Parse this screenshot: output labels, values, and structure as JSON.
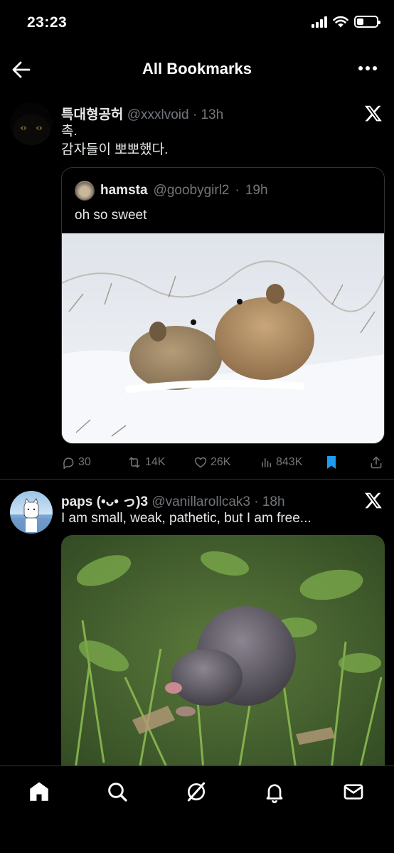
{
  "status_bar": {
    "time": "23:23",
    "battery_level": 0.35
  },
  "header": {
    "title": "All Bookmarks",
    "back_icon": "arrow-left-icon",
    "more_icon": "more-horizontal-icon"
  },
  "tweets": [
    {
      "display_name": "특대형공허",
      "handle": "@xxxlvoid",
      "time": "13h",
      "lines": [
        "촉.",
        "감자들이 뽀뽀했다."
      ],
      "quote": {
        "display_name": "hamsta",
        "handle": "@goobygirl2",
        "time": "19h",
        "text": "oh so sweet"
      },
      "actions": {
        "replies": "30",
        "retweets": "14K",
        "likes": "26K",
        "views": "843K",
        "bookmarked": true
      }
    },
    {
      "display_name": "paps (•ᴗ• っ)3",
      "handle": "@vanillarollcak3",
      "time": "18h",
      "text": "I am small, weak, pathetic, but I am free..."
    }
  ],
  "colors": {
    "background": "#000000",
    "text_primary": "#e7e9ea",
    "text_secondary": "#71767b",
    "accent": "#1d9bf0",
    "divider": "#2f3336"
  },
  "nav": [
    "home-icon",
    "search-icon",
    "grok-icon",
    "notifications-icon",
    "messages-icon"
  ]
}
